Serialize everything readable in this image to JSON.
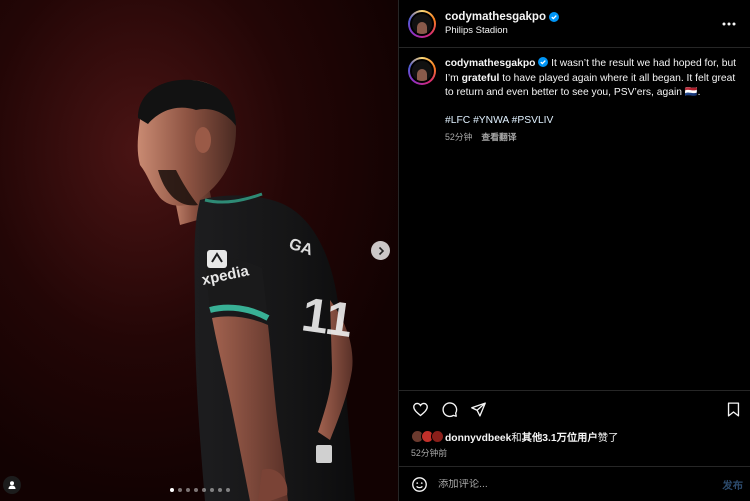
{
  "post": {
    "username": "codymathesgakpo",
    "location": "Philips Stadion",
    "verified": true
  },
  "caption": {
    "username": "codymathesgakpo",
    "text_before": " It wasn’t the result we had hoped for, but I’m ",
    "bold": "grateful",
    "text_after": " to have played again where it all began. It felt great to return and even better to see you, PSV’ers, again 🇳🇱.",
    "hashtags": [
      "#LFC",
      "#YNWA",
      "#PSVLIV"
    ],
    "time": "52分钟",
    "translate_label": "查看翻译"
  },
  "media": {
    "slide_count": 8,
    "active_slide": 1,
    "jersey_brand": "xpedia",
    "jersey_number": "11"
  },
  "actions": {
    "like_icon": "heart-icon",
    "comment_icon": "comment-icon",
    "share_icon": "share-icon",
    "save_icon": "bookmark-icon"
  },
  "likes": {
    "liker": "donnyvdbeek",
    "joiner": "和",
    "others": "其他3.1万位用户",
    "suffix": "赞了"
  },
  "post_time": "52分钟前",
  "comment": {
    "placeholder": "添加评论...",
    "post_label": "发布"
  },
  "colors": {
    "background": "#000000",
    "divider": "#262626",
    "verified_blue": "#0095f6",
    "muted_text": "#a8a8a8",
    "post_disabled": "#2c4a6b"
  }
}
